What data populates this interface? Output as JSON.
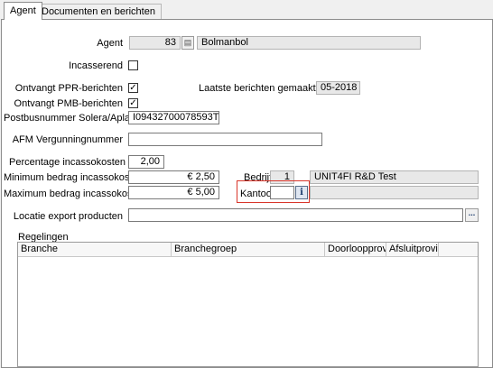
{
  "tabs": [
    {
      "label": "Agent",
      "active": true
    },
    {
      "label": "Documenten en berichten",
      "active": false
    }
  ],
  "form": {
    "agent": {
      "label": "Agent",
      "code": "83",
      "name": "Bolmanbol"
    },
    "incasserend": {
      "label": "Incasserend",
      "checked": false
    },
    "ppr": {
      "label": "Ontvangt PPR-berichten",
      "checked": true
    },
    "pmb": {
      "label": "Ontvangt PMB-berichten",
      "checked": true
    },
    "laatste_berichten": {
      "label": "Laatste berichten gemaakt op",
      "value": "05-2018"
    },
    "postbus": {
      "label": "Postbusnummer Solera/Aplaza",
      "value": "I09432700078593T"
    },
    "afm": {
      "label": "AFM Vergunningnummer",
      "value": ""
    },
    "percentage": {
      "label": "Percentage incassokosten",
      "value": "2,00"
    },
    "minimum": {
      "label": "Minimum bedrag incassokosten",
      "value": "€ 2,50"
    },
    "maximum": {
      "label": "Maximum bedrag incassokosten",
      "value": "€ 5,00"
    },
    "bedrijf": {
      "label": "Bedrijf",
      "code": "1",
      "name": "UNIT4FI R&D Test"
    },
    "kantoor": {
      "label": "Kantoor",
      "code": "",
      "name": ""
    },
    "locatie": {
      "label": "Locatie export producten",
      "value": "",
      "browse_label": "..."
    }
  },
  "regelingen": {
    "title": "Regelingen",
    "columns": [
      "Branche",
      "Branchegroep",
      "Doorloopprovisie",
      "Afsluitprovisie"
    ]
  },
  "colors": {
    "highlight": "#d9362b",
    "readonly_bg": "#e8e8e8",
    "info_button": "#dfe6f1"
  }
}
